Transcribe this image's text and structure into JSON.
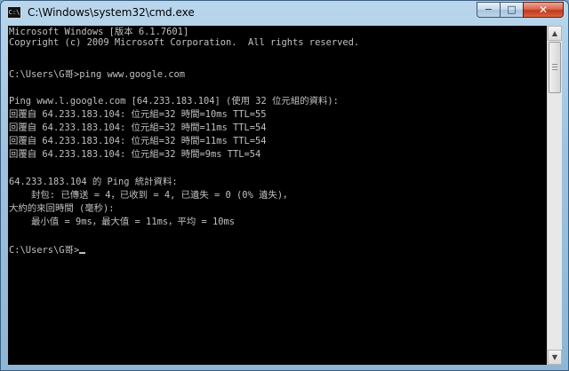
{
  "window": {
    "title": "C:\\Windows\\system32\\cmd.exe",
    "icon_text": "C:\\",
    "controls": {
      "minimize": "−",
      "maximize": "□",
      "close": "✕"
    }
  },
  "console": {
    "lines": [
      "Microsoft Windows [版本 6.1.7601]",
      "Copyright (c) 2009 Microsoft Corporation.  All rights reserved.",
      "",
      "C:\\Users\\G哥>ping www.google.com",
      "",
      "Ping www.l.google.com [64.233.183.104] (使用 32 位元組的資料):",
      "回覆自 64.233.183.104: 位元組=32 時間=10ms TTL=55",
      "回覆自 64.233.183.104: 位元組=32 時間=11ms TTL=54",
      "回覆自 64.233.183.104: 位元組=32 時間=11ms TTL=54",
      "回覆自 64.233.183.104: 位元組=32 時間=9ms TTL=54",
      "",
      "64.233.183.104 的 Ping 統計資料:",
      "    封包: 已傳送 = 4，已收到 = 4, 已遺失 = 0 (0% 遺失)，",
      "大約的來回時間 (毫秒):",
      "    最小值 = 9ms，最大值 = 11ms，平均 = 10ms",
      "",
      "C:\\Users\\G哥>"
    ],
    "colors": {
      "background": "#000000",
      "text": "#c0c0c0"
    }
  },
  "scrollbar": {
    "up_arrow": "▲",
    "down_arrow": "▼"
  }
}
